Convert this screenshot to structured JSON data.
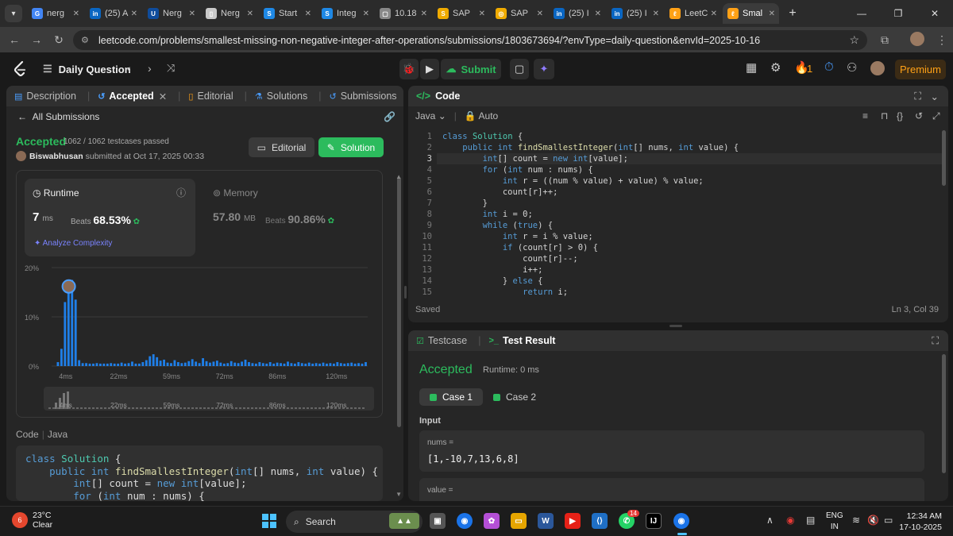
{
  "browser": {
    "tabs": [
      {
        "label": "nerg",
        "fav_color": "#4285f4",
        "fav_glyph": "G"
      },
      {
        "label": "(25) A",
        "fav_color": "#0a66c2",
        "fav_glyph": "in"
      },
      {
        "label": "Nerg",
        "fav_color": "#0f4c9c",
        "fav_glyph": "U"
      },
      {
        "label": "Nerg",
        "fav_color": "#c9c9c9",
        "fav_glyph": "▯"
      },
      {
        "label": "Start",
        "fav_color": "#1e88e5",
        "fav_glyph": "S"
      },
      {
        "label": "Integ",
        "fav_color": "#1e88e5",
        "fav_glyph": "S"
      },
      {
        "label": "10.18",
        "fav_color": "#888888",
        "fav_glyph": "▢"
      },
      {
        "label": "SAP",
        "fav_color": "#f0ab00",
        "fav_glyph": "S"
      },
      {
        "label": "SAP",
        "fav_color": "#f0ab00",
        "fav_glyph": "◎"
      },
      {
        "label": "(25) I",
        "fav_color": "#0a66c2",
        "fav_glyph": "in"
      },
      {
        "label": "(25) I",
        "fav_color": "#0a66c2",
        "fav_glyph": "in"
      },
      {
        "label": "LeetC",
        "fav_color": "#ffa116",
        "fav_glyph": "ℓ"
      },
      {
        "label": "Smal",
        "fav_color": "#ffa116",
        "fav_glyph": "ℓ",
        "active": true
      }
    ],
    "url": "leetcode.com/problems/smallest-missing-non-negative-integer-after-operations/submissions/1803673694/?envType=daily-question&envId=2025-10-16"
  },
  "nav": {
    "title": "Daily Question",
    "submit_label": "Submit",
    "streak": "1",
    "premium_label": "Premium"
  },
  "left": {
    "tabs": [
      "Description",
      "Accepted",
      "Editorial",
      "Solutions",
      "Submissions"
    ],
    "back_label": "All Submissions",
    "status": "Accepted",
    "testcases": "1062 / 1062 testcases passed",
    "user": "Biswabhusan",
    "submitted_text": "submitted at Oct 17, 2025 00:33",
    "editorial_btn": "Editorial",
    "solution_btn": "Solution",
    "runtime": {
      "label": "Runtime",
      "value": "7",
      "unit": "ms",
      "beats_label": "Beats",
      "beats": "68.53%"
    },
    "memory": {
      "label": "Memory",
      "value": "57.80",
      "unit": "MB",
      "beats_label": "Beats",
      "beats": "90.86%"
    },
    "analyze_label": "Analyze Complexity",
    "code_label": "Code",
    "code_lang": "Java",
    "code_lines": [
      "class Solution {",
      "    public int findSmallestInteger(int[] nums, int value) {",
      "        int[] count = new int[value];",
      "        for (int num : nums) {"
    ]
  },
  "chart_data": {
    "type": "bar",
    "title": "",
    "xlabel": "",
    "ylabel": "",
    "ylim": [
      0,
      20
    ],
    "y_ticks": [
      "0%",
      "10%",
      "20%"
    ],
    "x_ticks": [
      "4ms",
      "22ms",
      "59ms",
      "72ms",
      "86ms",
      "120ms"
    ],
    "mini_x_ticks": [
      "4ms",
      "22ms",
      "59ms",
      "72ms",
      "86ms",
      "120ms"
    ],
    "highlight_index": 3,
    "values": [
      0.8,
      3.5,
      13,
      16.5,
      17.5,
      13.5,
      1.2,
      0.6,
      0.6,
      0.5,
      0.5,
      0.6,
      0.5,
      0.5,
      0.5,
      0.6,
      0.5,
      0.5,
      0.7,
      0.5,
      0.6,
      0.9,
      0.5,
      0.5,
      0.8,
      1.2,
      2.0,
      2.4,
      1.8,
      1.1,
      1.3,
      0.7,
      0.6,
      1.2,
      0.8,
      0.6,
      0.7,
      1.0,
      1.4,
      0.9,
      0.6,
      1.6,
      1.0,
      0.7,
      0.9,
      1.1,
      0.7,
      0.5,
      0.6,
      1.0,
      0.7,
      0.6,
      0.9,
      1.3,
      0.8,
      0.6,
      0.5,
      0.8,
      0.6,
      0.5,
      0.8,
      0.5,
      0.7,
      0.6,
      0.5,
      0.9,
      0.6,
      0.5,
      0.8,
      0.6,
      0.5,
      0.7,
      0.5,
      0.6,
      0.5,
      0.7,
      0.5,
      0.6,
      0.5,
      0.8,
      0.6,
      0.5,
      0.6,
      0.7,
      0.5,
      0.6,
      0.5,
      0.8
    ],
    "bar_color": "#1f7fe8"
  },
  "code_panel": {
    "title": "Code",
    "lang": "Java",
    "mode": "Auto",
    "saved": "Saved",
    "cursor": "Ln 3, Col 39",
    "lines": [
      "class Solution {",
      "    public int findSmallestInteger(int[] nums, int value) {",
      "        int[] count = new int[value];",
      "        for (int num : nums) {",
      "            int r = ((num % value) + value) % value;",
      "            count[r]++;",
      "        }",
      "        int i = 0;",
      "        while (true) {",
      "            int r = i % value;",
      "            if (count[r] > 0) {",
      "                count[r]--;",
      "                i++;",
      "            } else {",
      "                return i;"
    ]
  },
  "result": {
    "tabs": [
      "Testcase",
      "Test Result"
    ],
    "status": "Accepted",
    "runtime": "Runtime: 0 ms",
    "cases": [
      "Case 1",
      "Case 2"
    ],
    "input_label": "Input",
    "nums_key": "nums =",
    "nums_val": "[1,-10,7,13,6,8]",
    "value_key": "value ="
  },
  "taskbar": {
    "temp": "23°C",
    "weather": "Clear",
    "weather_badge": "6",
    "search": "Search",
    "whatsapp_badge": "14",
    "lang1": "ENG",
    "lang2": "IN",
    "time": "12:34 AM",
    "date": "17-10-2025"
  }
}
